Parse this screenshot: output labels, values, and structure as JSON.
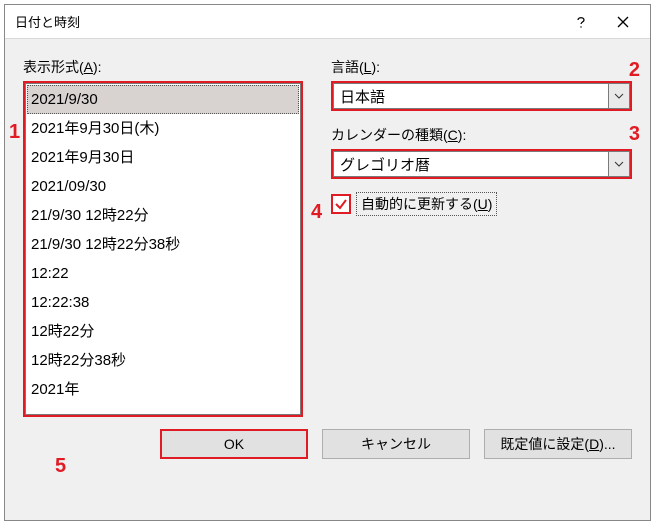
{
  "window": {
    "title": "日付と時刻"
  },
  "left": {
    "label_pre": "表示形式(",
    "label_accel": "A",
    "label_post": "):"
  },
  "formats": {
    "items": [
      "2021/9/30",
      "2021年9月30日(木)",
      "2021年9月30日",
      "2021/09/30",
      "21/9/30 12時22分",
      "21/9/30 12時22分38秒",
      "12:22",
      "12:22:38",
      "12時22分",
      "12時22分38秒",
      "2021年"
    ],
    "selected_index": 0
  },
  "language": {
    "label_pre": "言語(",
    "label_accel": "L",
    "label_post": "):",
    "value": "日本語"
  },
  "calendar": {
    "label_pre": "カレンダーの種類(",
    "label_accel": "C",
    "label_post": "):",
    "value": "グレゴリオ暦"
  },
  "auto_update": {
    "label_pre": "自動的に更新する(",
    "label_accel": "U",
    "label_post": ")",
    "checked": true
  },
  "buttons": {
    "ok": "OK",
    "cancel": "キャンセル",
    "default_pre": "既定値に設定(",
    "default_accel": "D",
    "default_post": ")..."
  },
  "callouts": {
    "c1": "1",
    "c2": "2",
    "c3": "3",
    "c4": "4",
    "c5": "5"
  }
}
